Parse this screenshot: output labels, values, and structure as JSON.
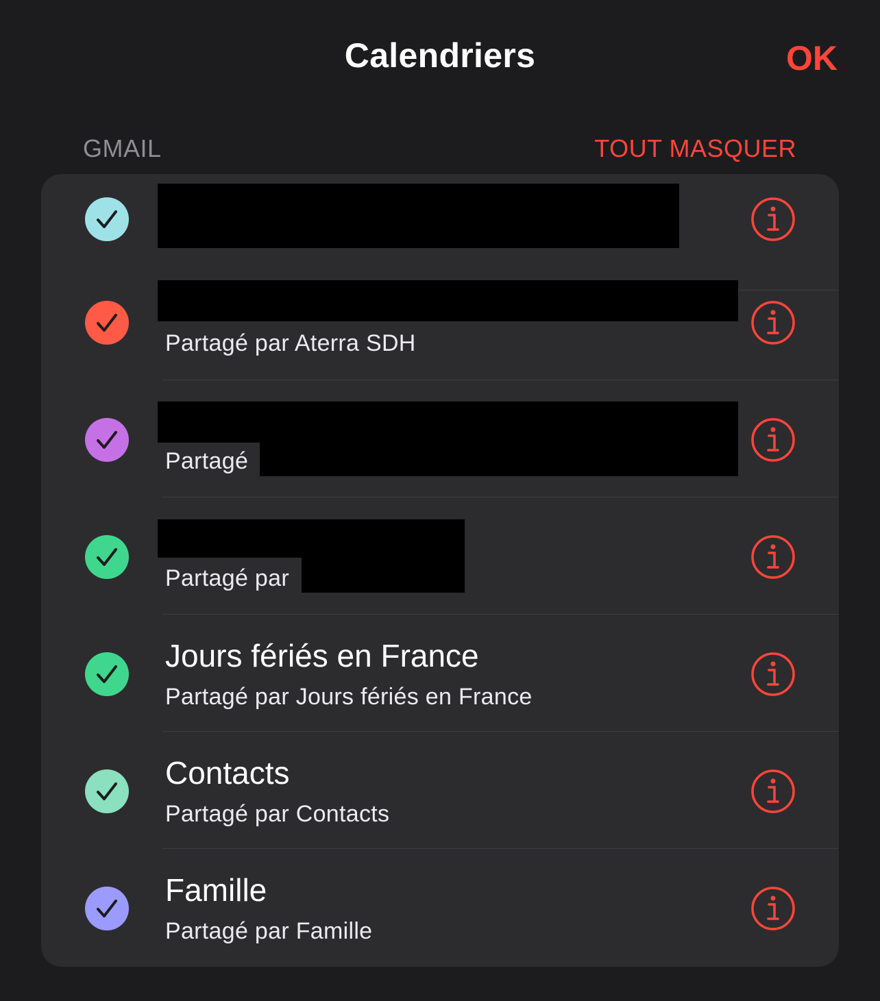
{
  "header": {
    "title": "Calendriers",
    "done_label": "OK"
  },
  "section": {
    "label": "GMAIL",
    "action_label": "TOUT MASQUER"
  },
  "colors": {
    "accent": "#ff453a",
    "background": "#1c1c1e",
    "group_background": "#2c2c2e"
  },
  "calendars": [
    {
      "title": "",
      "subtitle": "",
      "color": "#9ee2e7",
      "checked": true,
      "redacted": true
    },
    {
      "title": "",
      "subtitle": "Partagé par Aterra SDH",
      "color": "#ff5a45",
      "checked": true,
      "redacted": true
    },
    {
      "title": "",
      "subtitle": "Partagé",
      "color": "#c670e6",
      "checked": true,
      "redacted": true
    },
    {
      "title": "",
      "subtitle": "Partagé par",
      "color": "#3fd78e",
      "checked": true,
      "redacted": true
    },
    {
      "title": "Jours fériés en France",
      "subtitle": "Partagé par Jours fériés en France",
      "color": "#3fd78e",
      "checked": true,
      "redacted": false
    },
    {
      "title": "Contacts",
      "subtitle": "Partagé par Contacts",
      "color": "#8ae0bf",
      "checked": true,
      "redacted": false
    },
    {
      "title": "Famille",
      "subtitle": "Partagé par Famille",
      "color": "#9b9bff",
      "checked": true,
      "redacted": false
    }
  ],
  "icons": {
    "check": "checkmark-icon",
    "info": "info-icon"
  }
}
